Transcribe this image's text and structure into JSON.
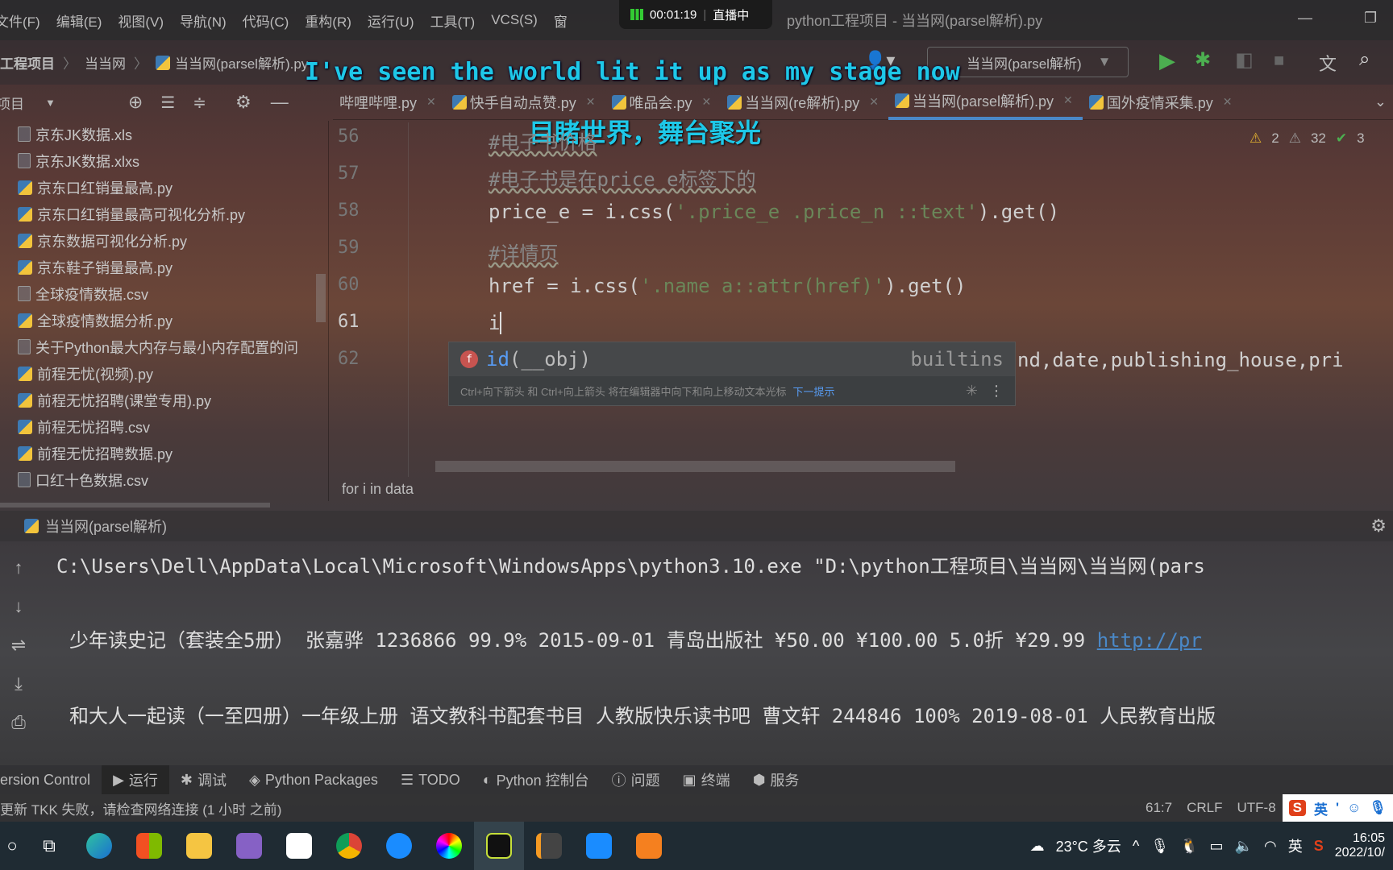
{
  "menu": [
    "文件(F)",
    "编辑(E)",
    "视图(V)",
    "导航(N)",
    "代码(C)",
    "重构(R)",
    "运行(U)",
    "工具(T)",
    "VCS(S)",
    "窗"
  ],
  "recording": {
    "time": "00:01:19",
    "status": "直播中"
  },
  "window_title": "python工程项目 - 当当网(parsel解析).py",
  "breadcrumb": [
    "工程项目",
    "当当网",
    "当当网(parsel解析).py"
  ],
  "run_config": "当当网(parsel解析)",
  "subtitle": {
    "en": "I've seen the world  lit it up as my stage now",
    "zh": "目睹世界，舞台聚光"
  },
  "project_panel": {
    "title": "项目"
  },
  "tabs": [
    {
      "label": "哔哩哔哩.py"
    },
    {
      "label": "快手自动点赞.py"
    },
    {
      "label": "唯品会.py"
    },
    {
      "label": "当当网(re解析).py"
    },
    {
      "label": "当当网(parsel解析).py",
      "active": true
    },
    {
      "label": "国外疫情采集.py"
    }
  ],
  "files": [
    "京东JK数据.xls",
    "京东JK数据.xlxs",
    "京东口红销量最高.py",
    "京东口红销量最高可视化分析.py",
    "京东数据可视化分析.py",
    "京东鞋子销量最高.py",
    "全球疫情数据.csv",
    "全球疫情数据分析.py",
    "关于Python最大内存与最小内存配置的问",
    "前程无忧(视频).py",
    "前程无忧招聘(课堂专用).py",
    "前程无忧招聘.csv",
    "前程无忧招聘数据.py",
    "口红十色数据.csv"
  ],
  "inspections": {
    "warnings": "2",
    "weak": "32",
    "ok": "3"
  },
  "code_lines": [
    {
      "n": "56",
      "text": "#电子书价格"
    },
    {
      "n": "57",
      "text": "#电子书是在price_e标签下的"
    },
    {
      "n": "58",
      "pre": "price_e = i.css(",
      "str": "'.price_e .price_n ::text'",
      "post": ").get()"
    },
    {
      "n": "59",
      "text": "#详情页"
    },
    {
      "n": "60",
      "pre": "href = i.css(",
      "str": "'.name a::attr(href)'",
      "post": ").get()"
    },
    {
      "n": "61",
      "text": "i"
    },
    {
      "n": "62",
      "text": "nd,date,publishing_house,pri"
    }
  ],
  "completion": {
    "item": "id",
    "args": "(__obj)",
    "source": "builtins",
    "hint": "Ctrl+向下箭头 和 Ctrl+向上箭头 将在编辑器中向下和向上移动文本光标",
    "next": "下一提示"
  },
  "editor_breadcrumb": "for i in data",
  "run_panel": {
    "title": "当当网(parsel解析)",
    "lines": [
      "C:\\Users\\Dell\\AppData\\Local\\Microsoft\\WindowsApps\\python3.10.exe \"D:\\python工程项目\\当当网\\当当网(pars",
      "少年读史记（套装全5册） 张嘉骅 1236866 99.9% 2015-09-01 青岛出版社 ¥50.00 ¥100.00 5.0折 ¥29.99 ",
      "和大人一起读（一至四册）一年级上册 语文教科书配套书目 人教版快乐读书吧 曹文轩 244846 100% 2019-08-01 人民教育出版"
    ],
    "link": "http://pr"
  },
  "tool_windows": [
    "ersion Control",
    "运行",
    "调试",
    "Python Packages",
    "TODO",
    "Python 控制台",
    "问题",
    "终端",
    "服务"
  ],
  "status": {
    "message": "更新 TKK 失败，请检查网络连接 (1 小时 之前)",
    "position": "61:7",
    "line_sep": "CRLF",
    "encoding": "UTF-8",
    "ime": "英"
  },
  "taskbar": {
    "weather": "23°C 多云",
    "lang": "英",
    "time": "16:05",
    "date": "2022/10/"
  },
  "colors": {
    "accent": "#4a88c7",
    "subtitle": "#1ec8e8",
    "run": "#4caf50"
  }
}
